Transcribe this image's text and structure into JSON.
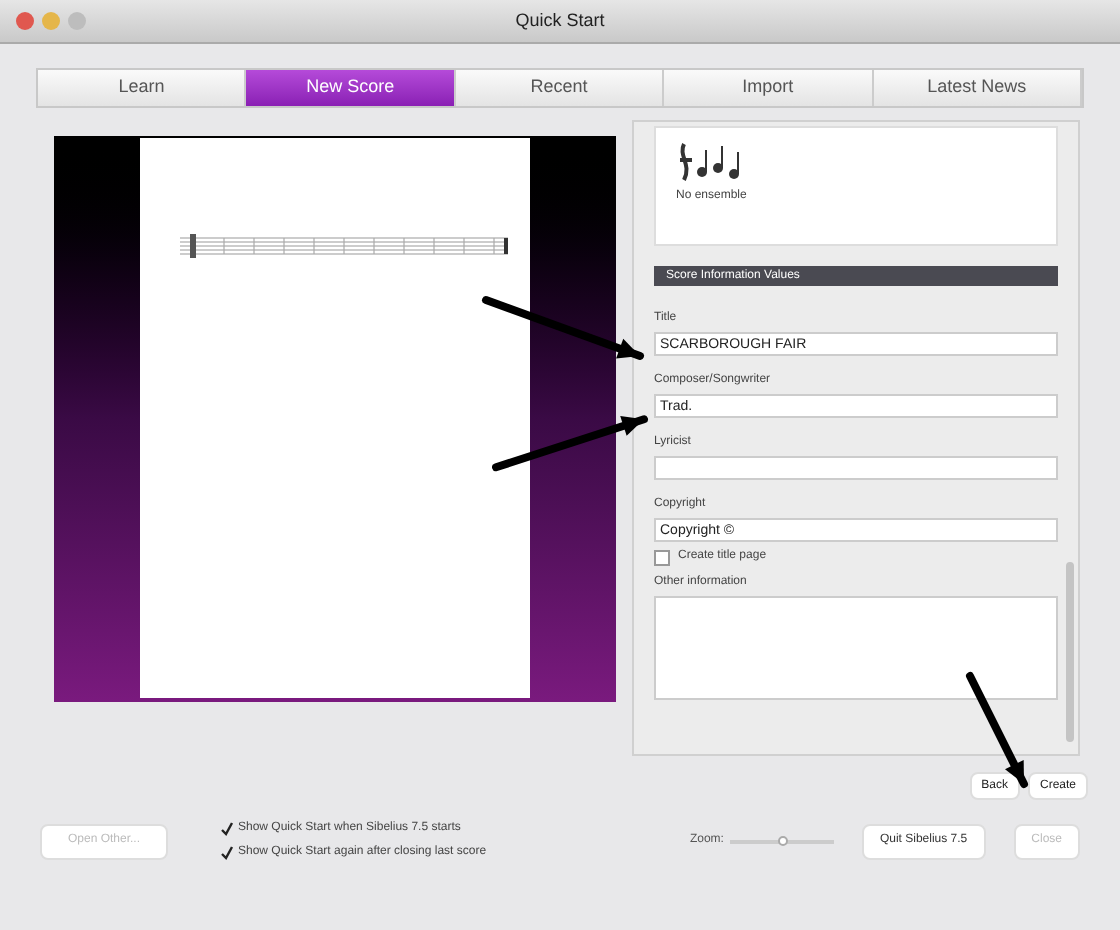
{
  "window": {
    "title": "Quick Start"
  },
  "tabs": [
    {
      "label": "Learn",
      "selected": false
    },
    {
      "label": "New Score",
      "selected": true
    },
    {
      "label": "Recent",
      "selected": false
    },
    {
      "label": "Import",
      "selected": false
    },
    {
      "label": "Latest News",
      "selected": false
    }
  ],
  "ensemble": {
    "label": "No ensemble"
  },
  "section_header": "Score Information Values",
  "fields": [
    {
      "kind": "text",
      "label": "Title",
      "value": "SCARBOROUGH FAIR"
    },
    {
      "kind": "text",
      "label": "Composer/Songwriter",
      "value": "Trad."
    },
    {
      "kind": "text",
      "label": "Lyricist"
    },
    {
      "kind": "text",
      "label": "Copyright",
      "value": "Copyright ©"
    },
    {
      "kind": "checkbox",
      "label": "Create title page",
      "checked": false
    },
    {
      "kind": "area",
      "label": "Other information"
    }
  ],
  "nav_buttons": [
    "Back",
    "Create"
  ],
  "footer": {
    "open_button": {
      "label": "Open Other...",
      "disabled": true
    },
    "options": [
      {
        "label": "Show Quick Start when Sibelius 7.5 starts",
        "checked": true
      },
      {
        "label": "Show Quick Start again after closing last score",
        "checked": true
      }
    ],
    "zoom": {
      "label": "Zoom:",
      "level": 0.5
    },
    "buttons": [
      {
        "label": "Quit Sibelius 7.5",
        "disabled": false
      },
      {
        "label": "Close",
        "disabled": true
      }
    ]
  }
}
